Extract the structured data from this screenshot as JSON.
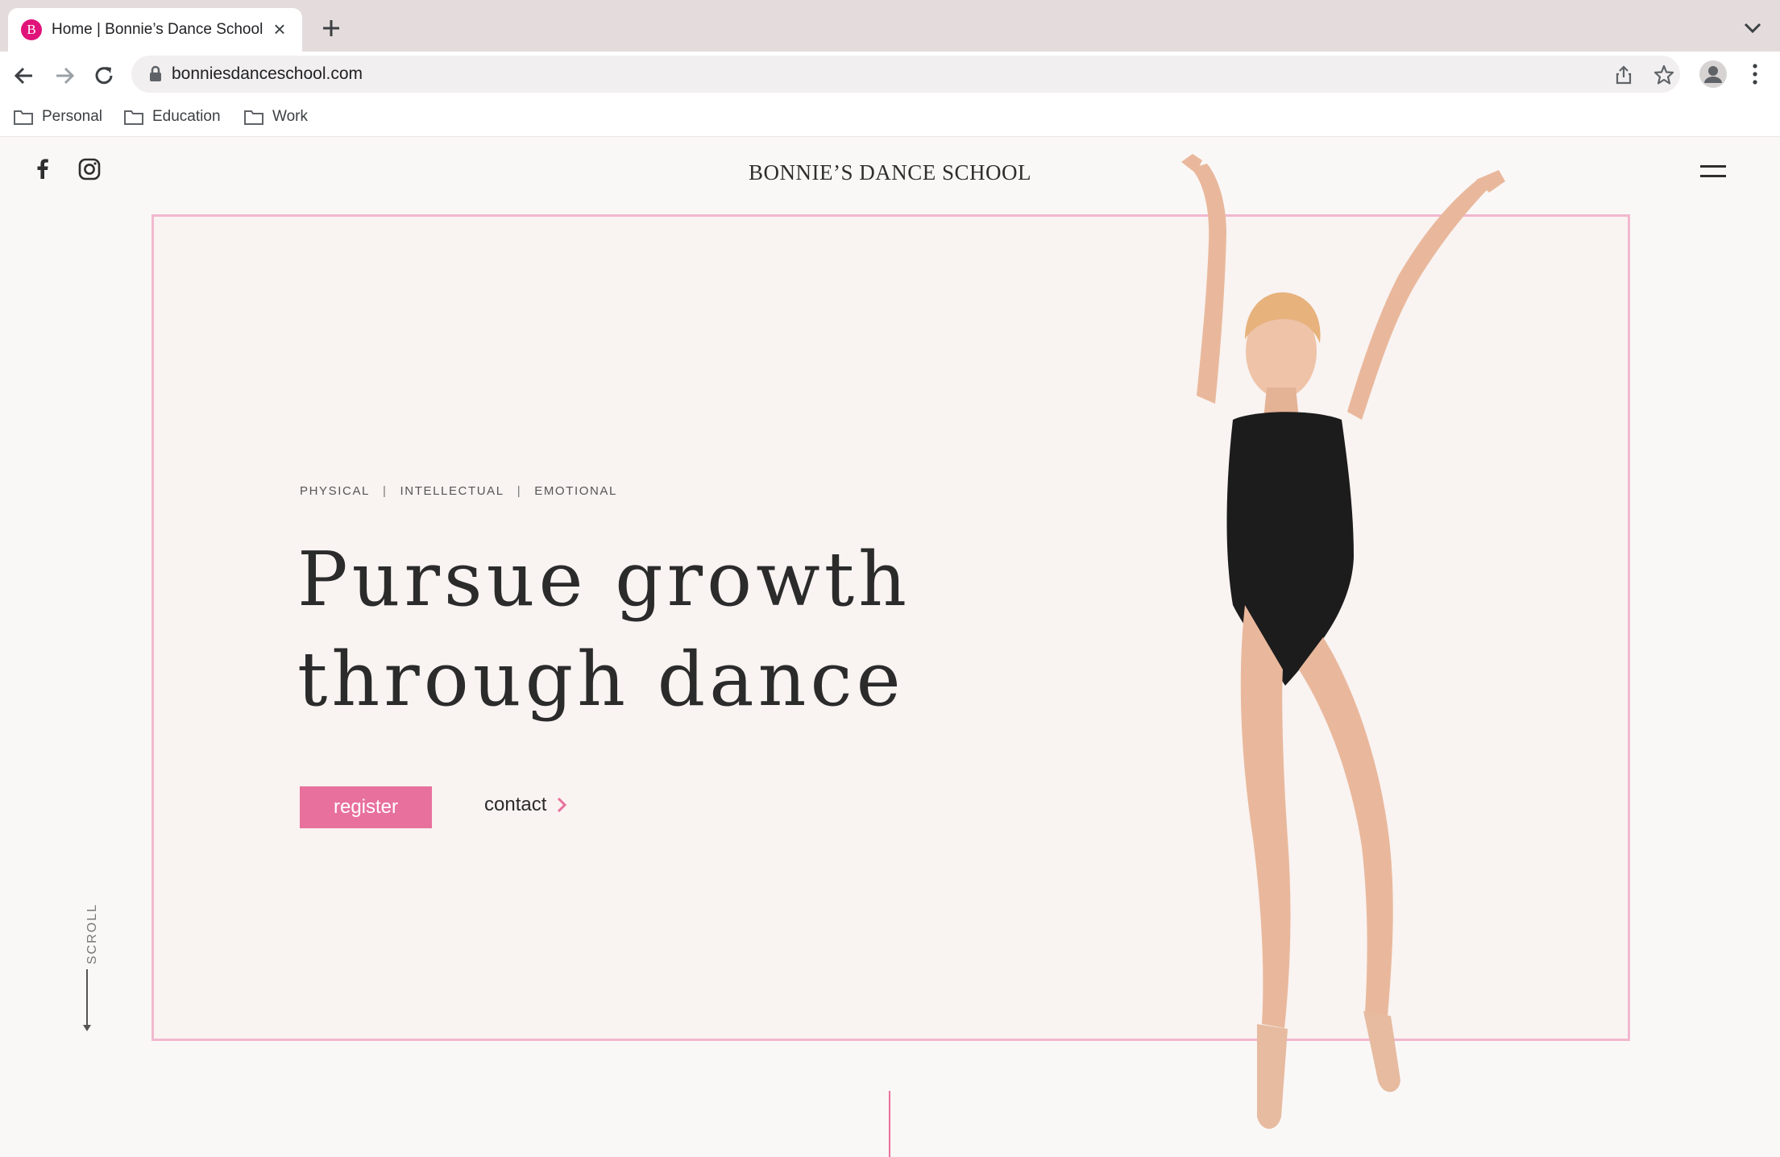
{
  "browser": {
    "tab": {
      "favicon_letter": "B",
      "title": "Home | Bonnie’s Dance School",
      "close_glyph": "×"
    },
    "address_bar": {
      "url": "bonniesdanceschool.com"
    },
    "bookmarks": [
      {
        "label": "Personal"
      },
      {
        "label": "Education"
      },
      {
        "label": "Work"
      }
    ]
  },
  "site": {
    "logo_text": "BONNIE’S DANCE SCHOOL",
    "social_icons": [
      "facebook-icon",
      "instagram-icon"
    ],
    "hero": {
      "kicker": [
        "PHYSICAL",
        "INTELLECTUAL",
        "EMOTIONAL"
      ],
      "kicker_separator": "|",
      "headline_line1": "Pursue growth",
      "headline_line2": "through dance",
      "register_label": "register",
      "contact_label": "contact"
    },
    "scroll_label": "SCROLL"
  },
  "colors": {
    "accent_pink": "#e8709c",
    "frame_border": "#f2b8cf",
    "favicon": "#e0137a"
  }
}
